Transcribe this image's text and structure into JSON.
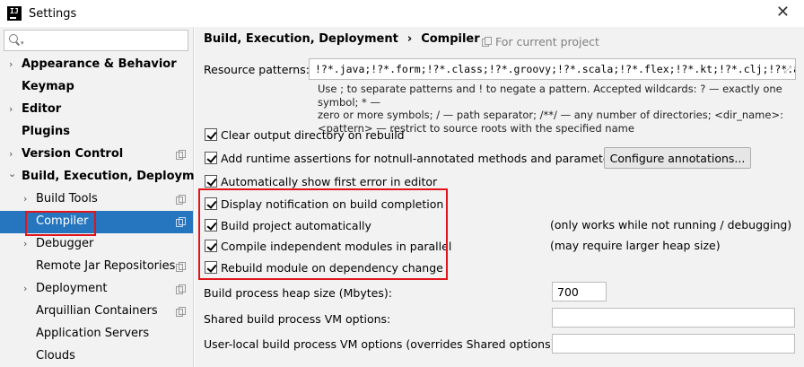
{
  "window": {
    "title": "Settings",
    "app_icon_text": "IJ"
  },
  "sidebar": {
    "search_placeholder": "",
    "items": [
      {
        "label": "Appearance & Behavior",
        "arrow": "›",
        "bold": true
      },
      {
        "label": "Keymap",
        "arrow": "",
        "bold": true
      },
      {
        "label": "Editor",
        "arrow": "›",
        "bold": true
      },
      {
        "label": "Plugins",
        "arrow": "",
        "bold": true
      },
      {
        "label": "Version Control",
        "arrow": "›",
        "bold": true
      },
      {
        "label": "Build, Execution, Deployment",
        "arrow": "⌄",
        "bold": true
      },
      {
        "label": "Build Tools",
        "arrow": "›",
        "bold": false
      },
      {
        "label": "Compiler",
        "arrow": "",
        "bold": false,
        "selected": true
      },
      {
        "label": "Debugger",
        "arrow": "›",
        "bold": false
      },
      {
        "label": "Remote Jar Repositories",
        "arrow": "",
        "bold": false
      },
      {
        "label": "Deployment",
        "arrow": "›",
        "bold": false
      },
      {
        "label": "Arquillian Containers",
        "arrow": "",
        "bold": false
      },
      {
        "label": "Application Servers",
        "arrow": "",
        "bold": false
      },
      {
        "label": "Clouds",
        "arrow": "",
        "bold": false
      }
    ]
  },
  "header": {
    "breadcrumb_parent": "Build, Execution, Deployment",
    "breadcrumb_sep": "›",
    "breadcrumb_current": "Compiler",
    "scope": "For current project"
  },
  "resource_patterns": {
    "label": "Resource patterns:",
    "value": "!?*.java;!?*.form;!?*.class;!?*.groovy;!?*.scala;!?*.flex;!?*.kt;!?*.clj;!?*.aj",
    "help_line1": "Use ; to separate patterns and ! to negate a pattern. Accepted wildcards: ? — exactly one symbol; * —",
    "help_line2": "zero or more symbols; / — path separator; /**/ — any number of directories; <dir_name>:",
    "help_line3": "<pattern> — restrict to source roots with the specified name"
  },
  "options": [
    {
      "label": "Clear output directory on rebuild",
      "checked": true,
      "note": ""
    },
    {
      "label": "Add runtime assertions for notnull-annotated methods and parameters",
      "checked": true,
      "note": ""
    },
    {
      "label": "Automatically show first error in editor",
      "checked": true,
      "note": ""
    },
    {
      "label": "Display notification on build completion",
      "checked": true,
      "note": ""
    },
    {
      "label": "Build project automatically",
      "checked": true,
      "note": "(only works while not running / debugging)"
    },
    {
      "label": "Compile independent modules in parallel",
      "checked": true,
      "note": "(may require larger heap size)"
    },
    {
      "label": "Rebuild module on dependency change",
      "checked": true,
      "note": ""
    }
  ],
  "configure_annotations_label": "Configure annotations...",
  "heap": {
    "label": "Build process heap size (Mbytes):",
    "value": "700"
  },
  "shared_vm": {
    "label": "Shared build process VM options:",
    "value": ""
  },
  "user_vm": {
    "label": "User-local build process VM options (overrides Shared options):",
    "value": ""
  }
}
